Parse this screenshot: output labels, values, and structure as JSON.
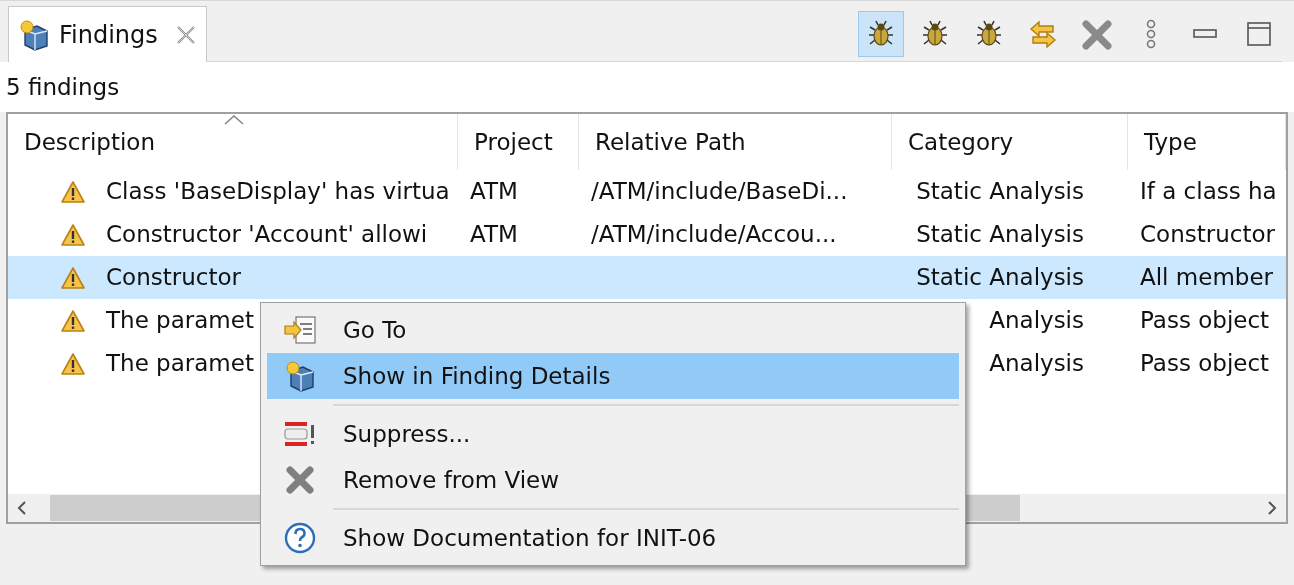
{
  "view_tab": {
    "title": "Findings",
    "selected": true
  },
  "toolbar": [
    {
      "kind": "bug",
      "selected": true
    },
    {
      "kind": "bug",
      "selected": false
    },
    {
      "kind": "bug",
      "selected": false
    },
    {
      "kind": "swap",
      "selected": false
    },
    {
      "kind": "remove",
      "selected": false
    },
    {
      "kind": "dots",
      "selected": false
    },
    {
      "kind": "minimize",
      "selected": false
    },
    {
      "kind": "maximize",
      "selected": false
    }
  ],
  "summary": "5 findings",
  "table": {
    "columns": [
      "Description",
      "Project",
      "Relative Path",
      "Category",
      "Type"
    ],
    "rows": [
      {
        "selected": false,
        "cells": [
          "Class 'BaseDisplay' has virtua",
          "ATM",
          "/ATM/include/BaseDi...",
          "Static Analysis",
          "If a class ha"
        ]
      },
      {
        "selected": false,
        "cells": [
          "Constructor 'Account' allowi",
          "ATM",
          "/ATM/include/Accou...",
          "Static Analysis",
          "Constructor"
        ]
      },
      {
        "selected": true,
        "cells": [
          "Constructor",
          "",
          "",
          "Static Analysis",
          "All member"
        ]
      },
      {
        "selected": false,
        "cells": [
          "The paramet",
          "",
          "",
          "Analysis",
          "Pass object"
        ]
      },
      {
        "selected": false,
        "cells": [
          "The paramet",
          "",
          "",
          "Analysis",
          "Pass object"
        ]
      }
    ]
  },
  "context_menu": [
    {
      "kind": "item",
      "label": "Go To",
      "selected": false
    },
    {
      "kind": "item",
      "label": "Show in Finding Details",
      "selected": true
    },
    {
      "kind": "separator"
    },
    {
      "kind": "item",
      "label": "Suppress...",
      "selected": false
    },
    {
      "kind": "item",
      "label": "Remove from View",
      "selected": false
    },
    {
      "kind": "separator"
    },
    {
      "kind": "item",
      "label": "Show Documentation for INIT-06",
      "selected": false
    }
  ]
}
